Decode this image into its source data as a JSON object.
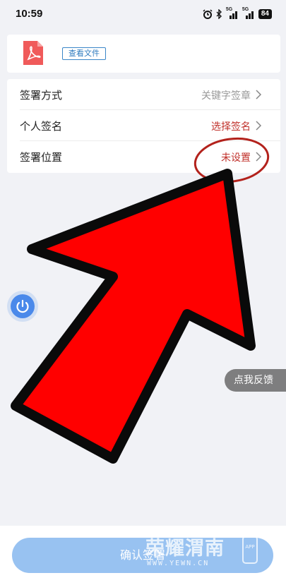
{
  "status_bar": {
    "time": "10:59",
    "signal_1_label": "5G",
    "signal_2_label": "5G",
    "battery": "84",
    "icons": [
      "alarm-icon",
      "bluetooth-icon",
      "signal-icon",
      "battery-icon"
    ]
  },
  "file": {
    "icon": "pdf-file-icon",
    "view_button_label": "查看文件"
  },
  "settings": [
    {
      "label": "签署方式",
      "value": "关键字签章",
      "value_color": "#999999"
    },
    {
      "label": "个人签名",
      "value": "选择签名",
      "value_color": "#c0312b"
    },
    {
      "label": "签署位置",
      "value": "未设置",
      "value_color": "#c0312b"
    }
  ],
  "feedback": {
    "label": "点我反馈"
  },
  "floating_button": {
    "icon": "power-icon"
  },
  "bottom": {
    "confirm_label": "确认签署"
  },
  "watermark": {
    "title": "荣耀渭南",
    "url": "WWW.YEWN.CN",
    "badge": "APP"
  },
  "colors": {
    "accent_blue": "#4a89ea",
    "confirm_button": "#98c2f1",
    "highlight_red": "#c0312b",
    "arrow_fill": "#ff0000"
  }
}
